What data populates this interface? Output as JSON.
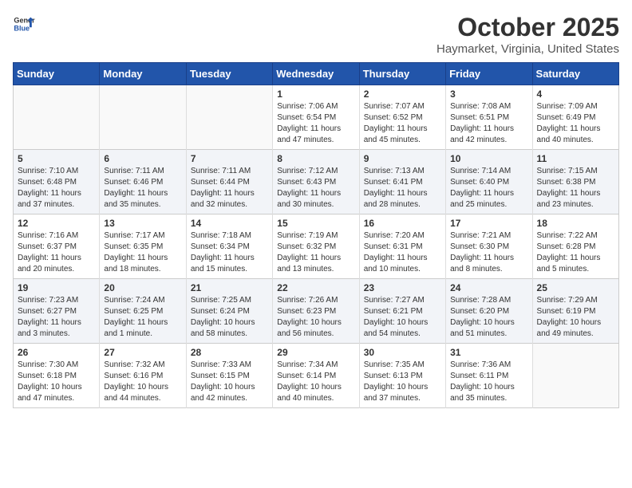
{
  "header": {
    "logo_general": "General",
    "logo_blue": "Blue",
    "title": "October 2025",
    "subtitle": "Haymarket, Virginia, United States"
  },
  "days_of_week": [
    "Sunday",
    "Monday",
    "Tuesday",
    "Wednesday",
    "Thursday",
    "Friday",
    "Saturday"
  ],
  "weeks": [
    [
      {
        "day": "",
        "info": ""
      },
      {
        "day": "",
        "info": ""
      },
      {
        "day": "",
        "info": ""
      },
      {
        "day": "1",
        "info": "Sunrise: 7:06 AM\nSunset: 6:54 PM\nDaylight: 11 hours\nand 47 minutes."
      },
      {
        "day": "2",
        "info": "Sunrise: 7:07 AM\nSunset: 6:52 PM\nDaylight: 11 hours\nand 45 minutes."
      },
      {
        "day": "3",
        "info": "Sunrise: 7:08 AM\nSunset: 6:51 PM\nDaylight: 11 hours\nand 42 minutes."
      },
      {
        "day": "4",
        "info": "Sunrise: 7:09 AM\nSunset: 6:49 PM\nDaylight: 11 hours\nand 40 minutes."
      }
    ],
    [
      {
        "day": "5",
        "info": "Sunrise: 7:10 AM\nSunset: 6:48 PM\nDaylight: 11 hours\nand 37 minutes."
      },
      {
        "day": "6",
        "info": "Sunrise: 7:11 AM\nSunset: 6:46 PM\nDaylight: 11 hours\nand 35 minutes."
      },
      {
        "day": "7",
        "info": "Sunrise: 7:11 AM\nSunset: 6:44 PM\nDaylight: 11 hours\nand 32 minutes."
      },
      {
        "day": "8",
        "info": "Sunrise: 7:12 AM\nSunset: 6:43 PM\nDaylight: 11 hours\nand 30 minutes."
      },
      {
        "day": "9",
        "info": "Sunrise: 7:13 AM\nSunset: 6:41 PM\nDaylight: 11 hours\nand 28 minutes."
      },
      {
        "day": "10",
        "info": "Sunrise: 7:14 AM\nSunset: 6:40 PM\nDaylight: 11 hours\nand 25 minutes."
      },
      {
        "day": "11",
        "info": "Sunrise: 7:15 AM\nSunset: 6:38 PM\nDaylight: 11 hours\nand 23 minutes."
      }
    ],
    [
      {
        "day": "12",
        "info": "Sunrise: 7:16 AM\nSunset: 6:37 PM\nDaylight: 11 hours\nand 20 minutes."
      },
      {
        "day": "13",
        "info": "Sunrise: 7:17 AM\nSunset: 6:35 PM\nDaylight: 11 hours\nand 18 minutes."
      },
      {
        "day": "14",
        "info": "Sunrise: 7:18 AM\nSunset: 6:34 PM\nDaylight: 11 hours\nand 15 minutes."
      },
      {
        "day": "15",
        "info": "Sunrise: 7:19 AM\nSunset: 6:32 PM\nDaylight: 11 hours\nand 13 minutes."
      },
      {
        "day": "16",
        "info": "Sunrise: 7:20 AM\nSunset: 6:31 PM\nDaylight: 11 hours\nand 10 minutes."
      },
      {
        "day": "17",
        "info": "Sunrise: 7:21 AM\nSunset: 6:30 PM\nDaylight: 11 hours\nand 8 minutes."
      },
      {
        "day": "18",
        "info": "Sunrise: 7:22 AM\nSunset: 6:28 PM\nDaylight: 11 hours\nand 5 minutes."
      }
    ],
    [
      {
        "day": "19",
        "info": "Sunrise: 7:23 AM\nSunset: 6:27 PM\nDaylight: 11 hours\nand 3 minutes."
      },
      {
        "day": "20",
        "info": "Sunrise: 7:24 AM\nSunset: 6:25 PM\nDaylight: 11 hours\nand 1 minute."
      },
      {
        "day": "21",
        "info": "Sunrise: 7:25 AM\nSunset: 6:24 PM\nDaylight: 10 hours\nand 58 minutes."
      },
      {
        "day": "22",
        "info": "Sunrise: 7:26 AM\nSunset: 6:23 PM\nDaylight: 10 hours\nand 56 minutes."
      },
      {
        "day": "23",
        "info": "Sunrise: 7:27 AM\nSunset: 6:21 PM\nDaylight: 10 hours\nand 54 minutes."
      },
      {
        "day": "24",
        "info": "Sunrise: 7:28 AM\nSunset: 6:20 PM\nDaylight: 10 hours\nand 51 minutes."
      },
      {
        "day": "25",
        "info": "Sunrise: 7:29 AM\nSunset: 6:19 PM\nDaylight: 10 hours\nand 49 minutes."
      }
    ],
    [
      {
        "day": "26",
        "info": "Sunrise: 7:30 AM\nSunset: 6:18 PM\nDaylight: 10 hours\nand 47 minutes."
      },
      {
        "day": "27",
        "info": "Sunrise: 7:32 AM\nSunset: 6:16 PM\nDaylight: 10 hours\nand 44 minutes."
      },
      {
        "day": "28",
        "info": "Sunrise: 7:33 AM\nSunset: 6:15 PM\nDaylight: 10 hours\nand 42 minutes."
      },
      {
        "day": "29",
        "info": "Sunrise: 7:34 AM\nSunset: 6:14 PM\nDaylight: 10 hours\nand 40 minutes."
      },
      {
        "day": "30",
        "info": "Sunrise: 7:35 AM\nSunset: 6:13 PM\nDaylight: 10 hours\nand 37 minutes."
      },
      {
        "day": "31",
        "info": "Sunrise: 7:36 AM\nSunset: 6:11 PM\nDaylight: 10 hours\nand 35 minutes."
      },
      {
        "day": "",
        "info": ""
      }
    ]
  ]
}
